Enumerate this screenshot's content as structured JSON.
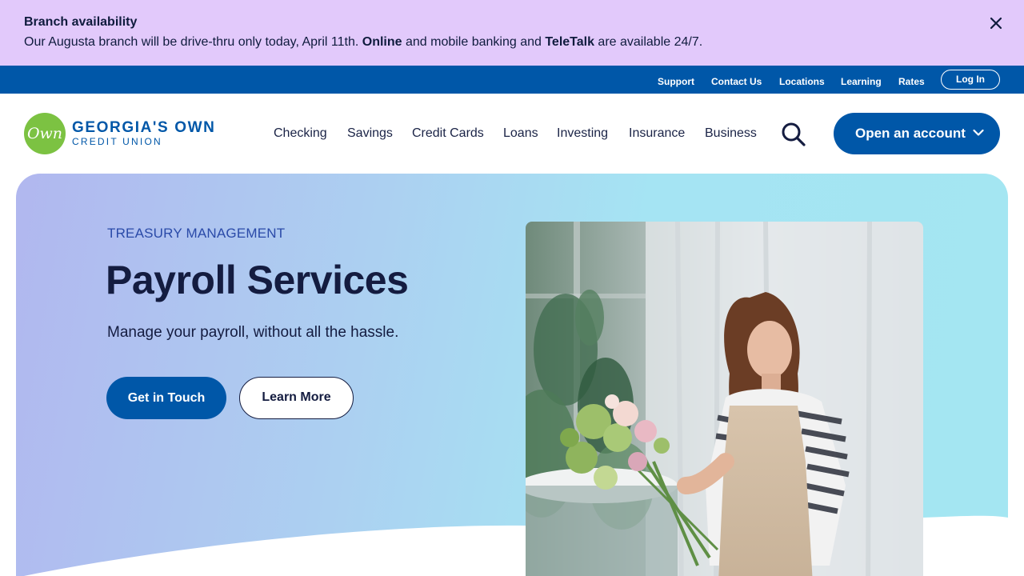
{
  "alert": {
    "title": "Branch availability",
    "message_prefix": "Our Augusta branch will be drive-thru only today, April 11th. ",
    "message_bold_1": "Online",
    "message_middle": " and mobile banking and ",
    "message_bold_2": "TeleTalk",
    "message_suffix": " are available 24/7.",
    "close_icon": "close-icon"
  },
  "utility": {
    "links": [
      "Support",
      "Contact Us",
      "Locations",
      "Learning",
      "Rates"
    ],
    "login_label": "Log In"
  },
  "logo": {
    "mark": "Own",
    "name": "GEORGIA'S OWN",
    "sub": "CREDIT UNION"
  },
  "nav": {
    "items": [
      "Checking",
      "Savings",
      "Credit Cards",
      "Loans",
      "Investing",
      "Insurance",
      "Business"
    ],
    "search_icon": "search-icon",
    "cta_label": "Open an account"
  },
  "hero": {
    "eyebrow": "TREASURY MANAGEMENT",
    "title": "Payroll Services",
    "subtitle": "Manage your payroll, without all the hassle.",
    "primary_button": "Get in Touch",
    "secondary_button": "Learn More"
  },
  "colors": {
    "alert_bg": "#e2c9fb",
    "brand_blue": "#0057a8",
    "logo_green": "#7cc242",
    "text_dark": "#141c40"
  }
}
